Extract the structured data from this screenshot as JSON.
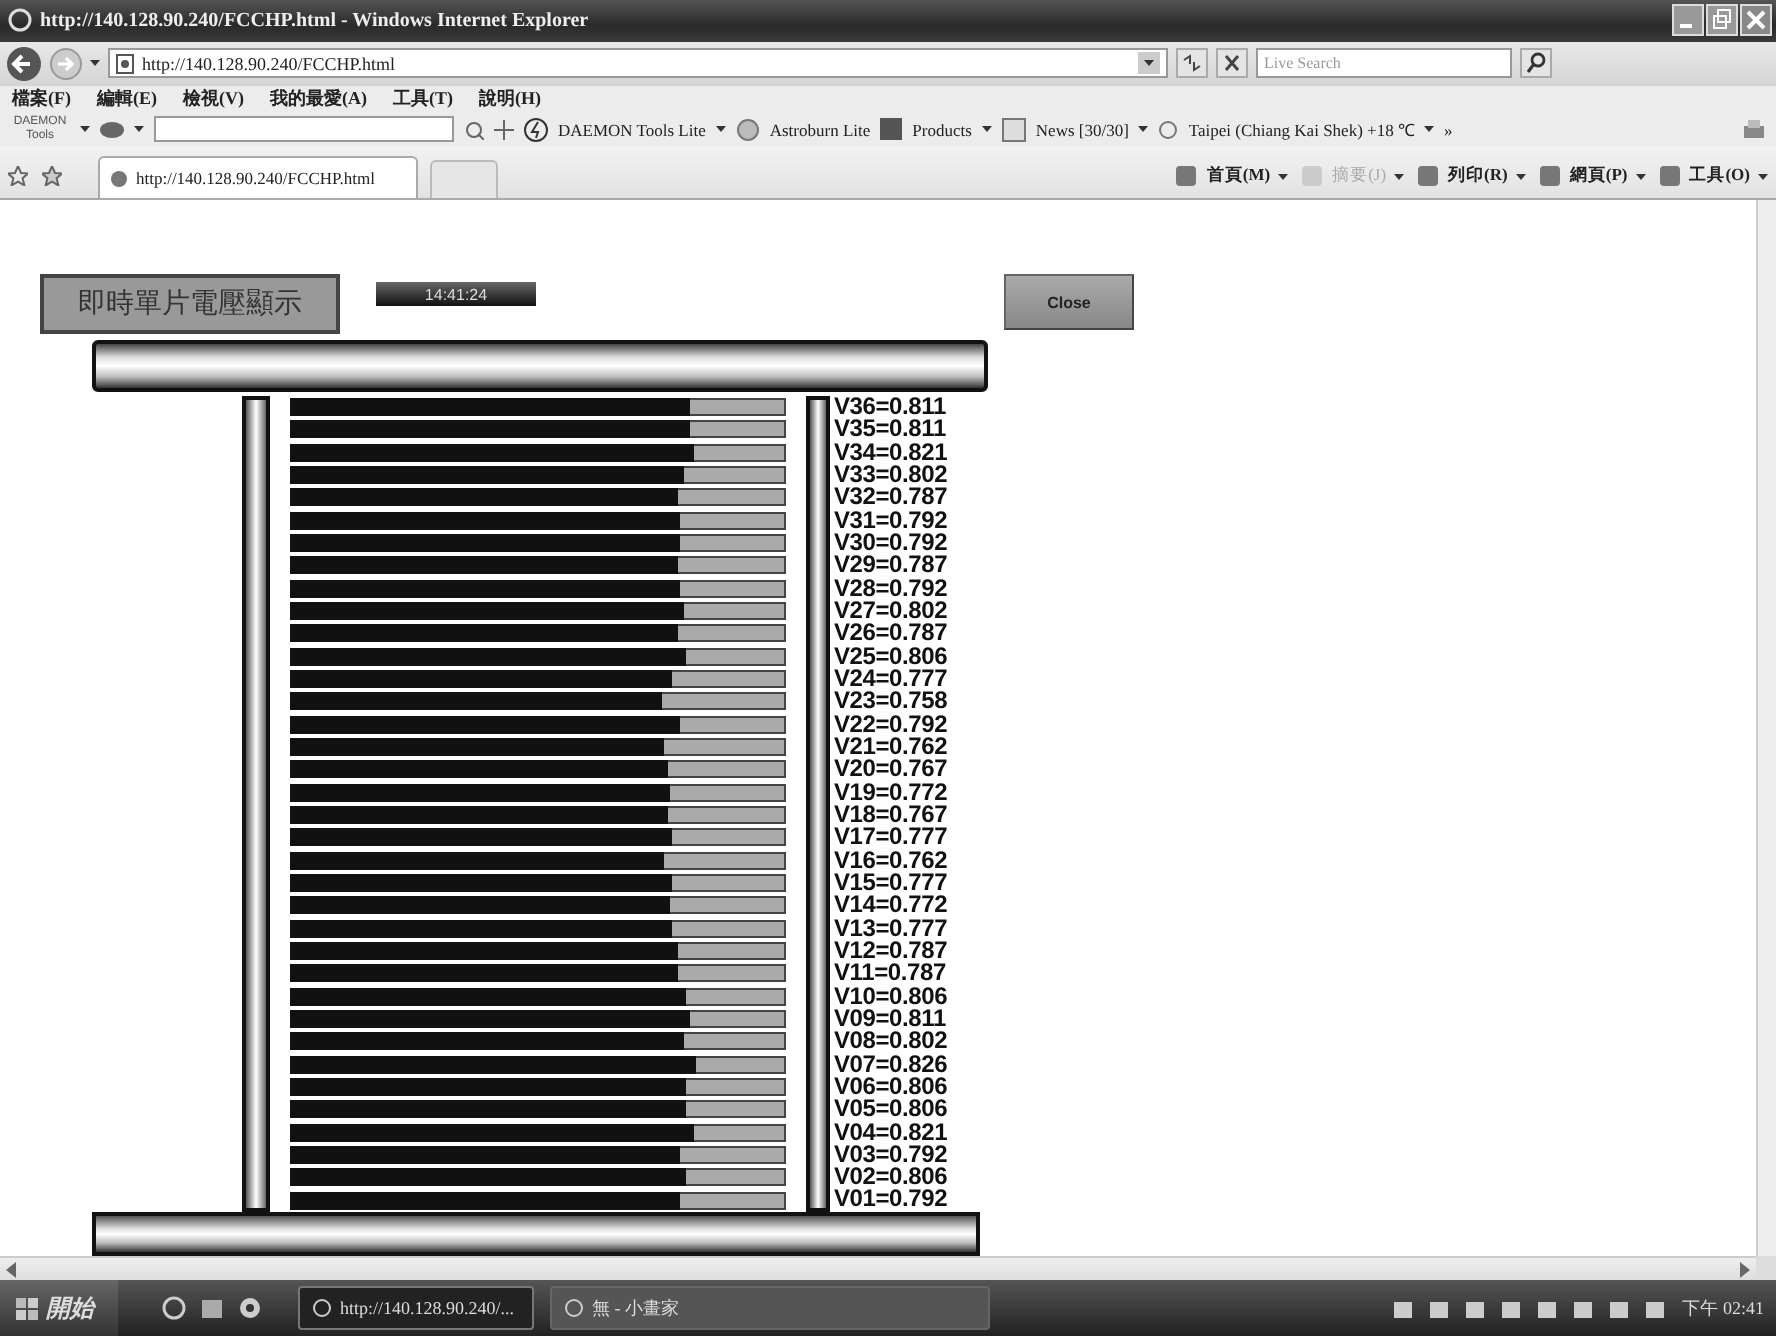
{
  "window": {
    "title": "http://140.128.90.240/FCCHP.html - Windows Internet Explorer"
  },
  "address_bar": {
    "url": "http://140.128.90.240/FCCHP.html",
    "search_placeholder": "Live Search"
  },
  "menu": [
    "檔案(F)",
    "編輯(E)",
    "檢視(V)",
    "我的最愛(A)",
    "工具(T)",
    "說明(H)"
  ],
  "toolbar": {
    "logo": "DAEMON Tools",
    "items": [
      "DAEMON Tools Lite",
      "Astroburn Lite",
      "Products",
      "News [30/30]",
      "Taipei (Chiang Kai Shek) +18 ℃"
    ],
    "more": "»"
  },
  "tabs": [
    {
      "label": "http://140.128.90.240/FCCHP.html",
      "selected": true
    }
  ],
  "command_bar": [
    {
      "label": "首頁(M)",
      "disabled": false
    },
    {
      "label": "摘要(J)",
      "disabled": true
    },
    {
      "label": "列印(R)",
      "disabled": false
    },
    {
      "label": "網頁(P)",
      "disabled": false
    },
    {
      "label": "工具(O)",
      "disabled": false
    }
  ],
  "page": {
    "title": "即時單片電壓顯示",
    "clock": "14:41:24",
    "close_button": "Close",
    "cells": [
      {
        "label": "V36=0.811",
        "level": 0.811
      },
      {
        "label": "V35=0.811",
        "level": 0.811
      },
      {
        "label": "V34=0.821",
        "level": 0.821
      },
      {
        "label": "V33=0.802",
        "level": 0.802
      },
      {
        "label": "V32=0.787",
        "level": 0.787
      },
      {
        "label": "V31=0.792",
        "level": 0.792
      },
      {
        "label": "V30=0.792",
        "level": 0.792
      },
      {
        "label": "V29=0.787",
        "level": 0.787
      },
      {
        "label": "V28=0.792",
        "level": 0.792
      },
      {
        "label": "V27=0.802",
        "level": 0.802
      },
      {
        "label": "V26=0.787",
        "level": 0.787
      },
      {
        "label": "V25=0.806",
        "level": 0.806
      },
      {
        "label": "V24=0.777",
        "level": 0.777
      },
      {
        "label": "V23=0.758",
        "level": 0.758
      },
      {
        "label": "V22=0.792",
        "level": 0.792
      },
      {
        "label": "V21=0.762",
        "level": 0.762
      },
      {
        "label": "V20=0.767",
        "level": 0.767
      },
      {
        "label": "V19=0.772",
        "level": 0.772
      },
      {
        "label": "V18=0.767",
        "level": 0.767
      },
      {
        "label": "V17=0.777",
        "level": 0.777
      },
      {
        "label": "V16=0.762",
        "level": 0.762
      },
      {
        "label": "V15=0.777",
        "level": 0.777
      },
      {
        "label": "V14=0.772",
        "level": 0.772
      },
      {
        "label": "V13=0.777",
        "level": 0.777
      },
      {
        "label": "V12=0.787",
        "level": 0.787
      },
      {
        "label": "V11=0.787",
        "level": 0.787
      },
      {
        "label": "V10=0.806",
        "level": 0.806
      },
      {
        "label": "V09=0.811",
        "level": 0.811
      },
      {
        "label": "V08=0.802",
        "level": 0.802
      },
      {
        "label": "V07=0.826",
        "level": 0.826
      },
      {
        "label": "V06=0.806",
        "level": 0.806
      },
      {
        "label": "V05=0.806",
        "level": 0.806
      },
      {
        "label": "V04=0.821",
        "level": 0.821
      },
      {
        "label": "V03=0.792",
        "level": 0.792
      },
      {
        "label": "V02=0.806",
        "level": 0.806
      },
      {
        "label": "V01=0.792",
        "level": 0.792
      }
    ]
  },
  "taskbar": {
    "start": "開始",
    "windows": [
      {
        "label": "http://140.128.90.240/...",
        "selected": true
      },
      {
        "label": "無 - 小畫家",
        "selected": false
      }
    ],
    "clock": "下午 02:41"
  }
}
